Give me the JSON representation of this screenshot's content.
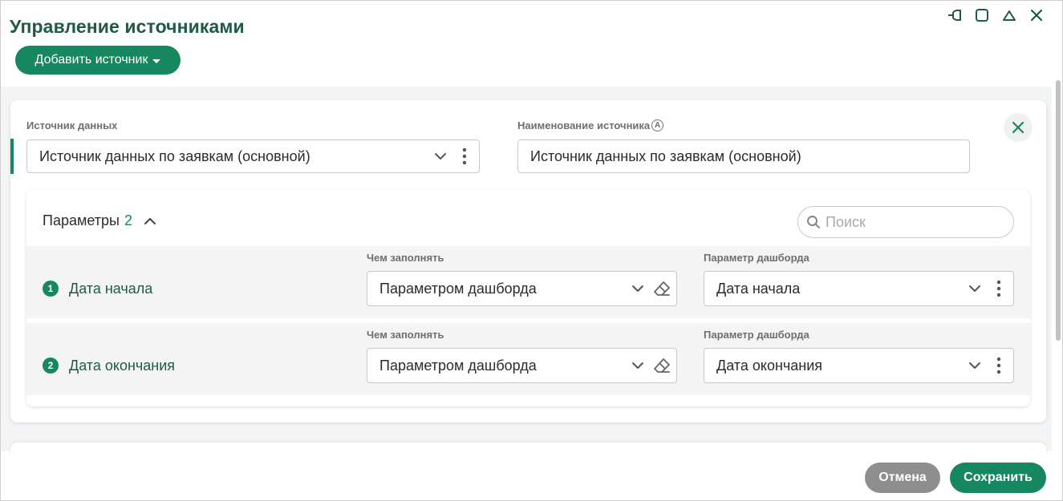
{
  "window": {
    "title": "Управление источниками",
    "controls": [
      "pin-icon",
      "maximize-icon",
      "collapse-icon",
      "close-icon"
    ]
  },
  "toolbar": {
    "add_source_label": "Добавить источник"
  },
  "source": {
    "data_source_label": "Источник данных",
    "data_source_value": "Источник данных по заявкам (основной)",
    "name_label": "Наименование источника",
    "name_badge": "A",
    "name_value": "Источник данных по заявкам (основной)"
  },
  "params": {
    "title": "Параметры",
    "count": "2",
    "search_placeholder": "Поиск",
    "rows": [
      {
        "index": "1",
        "name": "Дата начала",
        "fill_label": "Чем заполнять",
        "fill_value": "Параметром дашборда",
        "dash_label": "Параметр дашборда",
        "dash_value": "Дата начала"
      },
      {
        "index": "2",
        "name": "Дата окончания",
        "fill_label": "Чем заполнять",
        "fill_value": "Параметром дашборда",
        "dash_label": "Параметр дашборда",
        "dash_value": "Дата окончания"
      }
    ]
  },
  "footer": {
    "cancel_label": "Отмена",
    "save_label": "Сохранить"
  },
  "colors": {
    "accent": "#16875e",
    "title": "#1e5a47",
    "cancel": "#8e8e8e"
  }
}
